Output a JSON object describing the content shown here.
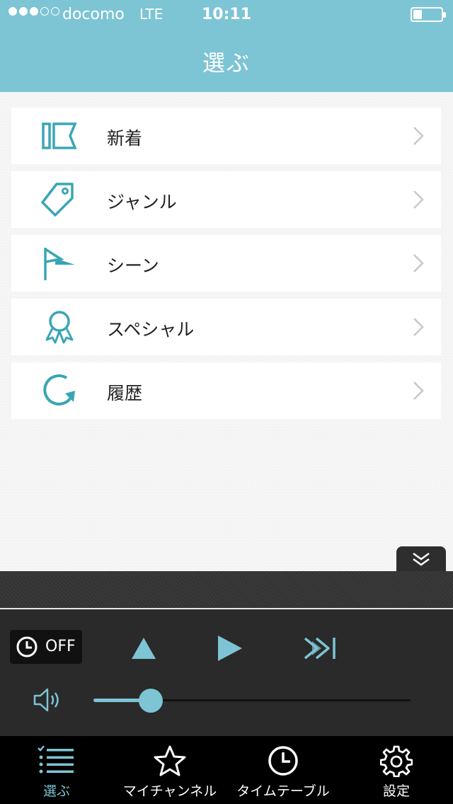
{
  "status_bar": {
    "carrier": "docomo",
    "network": "LTE",
    "time": "10:11",
    "signal_full": 3,
    "signal_total": 5
  },
  "nav": {
    "title": "選ぶ"
  },
  "menu": [
    {
      "label": "新着",
      "icon": "new-arrivals-icon"
    },
    {
      "label": "ジャンル",
      "icon": "tag-icon"
    },
    {
      "label": "シーン",
      "icon": "flag-icon"
    },
    {
      "label": "スペシャル",
      "icon": "ribbon-award-icon"
    },
    {
      "label": "履歴",
      "icon": "history-refresh-icon"
    }
  ],
  "player": {
    "timer_label": "OFF",
    "volume_level": 0.18
  },
  "tabs": [
    {
      "label": "選ぶ",
      "icon": "list-check-icon",
      "active": true
    },
    {
      "label": "マイチャンネル",
      "icon": "star-icon",
      "active": false
    },
    {
      "label": "タイムテーブル",
      "icon": "clock-icon",
      "active": false
    },
    {
      "label": "設定",
      "icon": "gear-icon",
      "active": false
    }
  ],
  "colors": {
    "accent": "#7dc4d4",
    "icon_teal": "#3aa5b5",
    "player_bg": "#2a2a2a",
    "tab_bg": "#000000"
  }
}
